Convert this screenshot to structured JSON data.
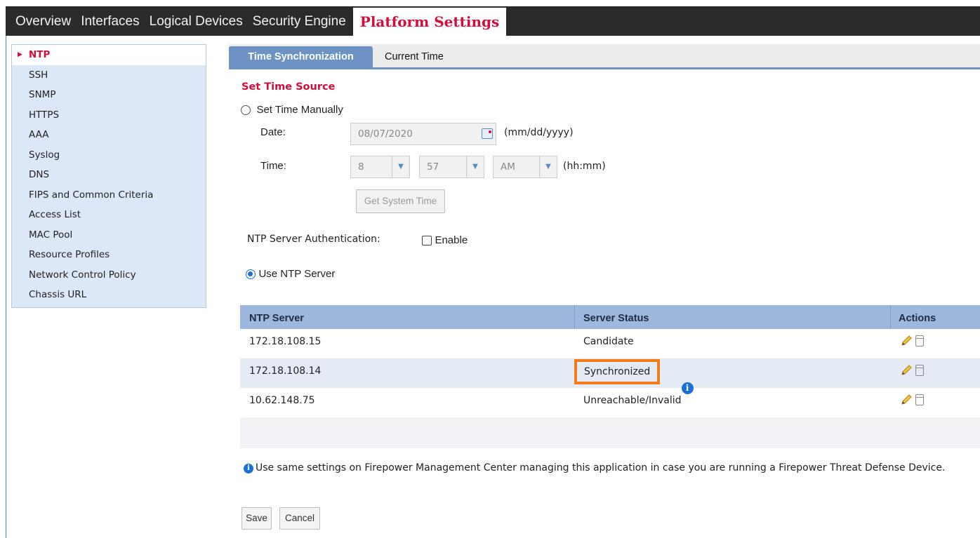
{
  "topnav": {
    "tabs": [
      "Overview",
      "Interfaces",
      "Logical Devices",
      "Security Engine"
    ],
    "active_tab": "Platform Settings"
  },
  "sidebar": {
    "items": [
      {
        "label": "NTP"
      },
      {
        "label": "SSH"
      },
      {
        "label": "SNMP"
      },
      {
        "label": "HTTPS"
      },
      {
        "label": "AAA"
      },
      {
        "label": "Syslog"
      },
      {
        "label": "DNS"
      },
      {
        "label": "FIPS and Common Criteria"
      },
      {
        "label": "Access List"
      },
      {
        "label": "MAC Pool"
      },
      {
        "label": "Resource Profiles"
      },
      {
        "label": "Network Control Policy"
      },
      {
        "label": "Chassis URL"
      }
    ]
  },
  "tabs": {
    "active": "Time Synchronization",
    "other": "Current Time"
  },
  "form": {
    "section_title": "Set Time Source",
    "manual_label": "Set Time Manually",
    "date_label": "Date:",
    "date_value": "08/07/2020",
    "date_hint": "(mm/dd/yyyy)",
    "time_label": "Time:",
    "hour": "8",
    "minute": "57",
    "ampm": "AM",
    "time_hint": "(hh:mm)",
    "get_system_time": "Get System Time",
    "auth_label": "NTP Server Authentication:",
    "enable_label": "Enable",
    "use_ntp_label": "Use NTP Server"
  },
  "table": {
    "headers": [
      "NTP Server",
      "Server Status",
      "Actions"
    ],
    "rows": [
      {
        "server": "172.18.108.15",
        "status": "Candidate"
      },
      {
        "server": "172.18.108.14",
        "status": "Synchronized"
      },
      {
        "server": "10.62.148.75",
        "status": "Unreachable/Invalid"
      }
    ]
  },
  "note": "Use same settings on Firepower Management Center managing this application in case you are running a Firepower Threat Defense Device.",
  "buttons": {
    "save": "Save",
    "cancel": "Cancel"
  },
  "colors": {
    "accent_red": "#d0103a",
    "tab_blue": "#6d93c4",
    "highlight_orange": "#f07d1a"
  }
}
